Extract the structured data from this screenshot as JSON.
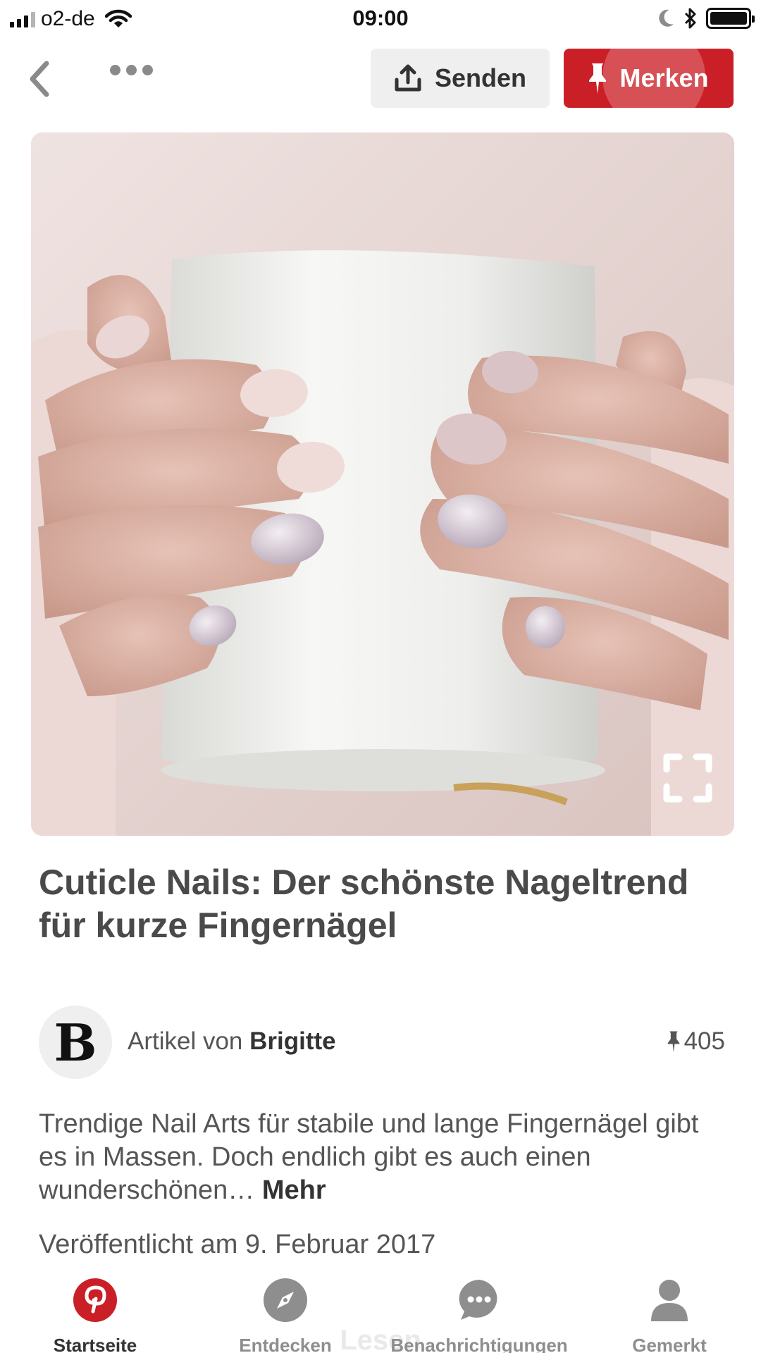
{
  "status_bar": {
    "carrier": "o2-de",
    "time": "09:00",
    "icons": [
      "signal-icon",
      "wifi-icon",
      "moon-icon",
      "bluetooth-icon",
      "battery-icon"
    ]
  },
  "toolbar": {
    "back_icon": "chevron-left-icon",
    "more_icon": "ellipsis-icon",
    "send_label": "Senden",
    "send_icon": "share-upload-icon",
    "save_label": "Merken",
    "save_icon": "pushpin-icon"
  },
  "pin": {
    "image_alt": "hands-holding-white-mug-with-nail-art",
    "expand_icon": "expand-icon",
    "title": "Cuticle Nails: Der schönste Nageltrend für kurze Fingernägel",
    "source": {
      "avatar_letter": "B",
      "prefix": "Artikel von",
      "name": "Brigitte"
    },
    "save_count": "405",
    "description": "Trendige Nail Arts für stabile und lange Fingernägel gibt es in Massen. Doch endlich gibt es auch einen wunderschönen…",
    "more_label": "Mehr",
    "published": "Veröffentlicht am 9. Februar 2017",
    "behind_tab_text": "Lesen"
  },
  "tabs": [
    {
      "label": "Startseite",
      "icon": "pinterest-logo-icon",
      "active": true
    },
    {
      "label": "Entdecken",
      "icon": "compass-icon",
      "active": false
    },
    {
      "label": "Benachrichtigungen",
      "icon": "chat-bubble-icon",
      "active": false
    },
    {
      "label": "Gemerkt",
      "icon": "person-icon",
      "active": false
    }
  ],
  "colors": {
    "brand_red": "#cb1f27",
    "text_dark": "#333333",
    "text_muted": "#8e8e8e",
    "button_grey": "#efefef"
  }
}
